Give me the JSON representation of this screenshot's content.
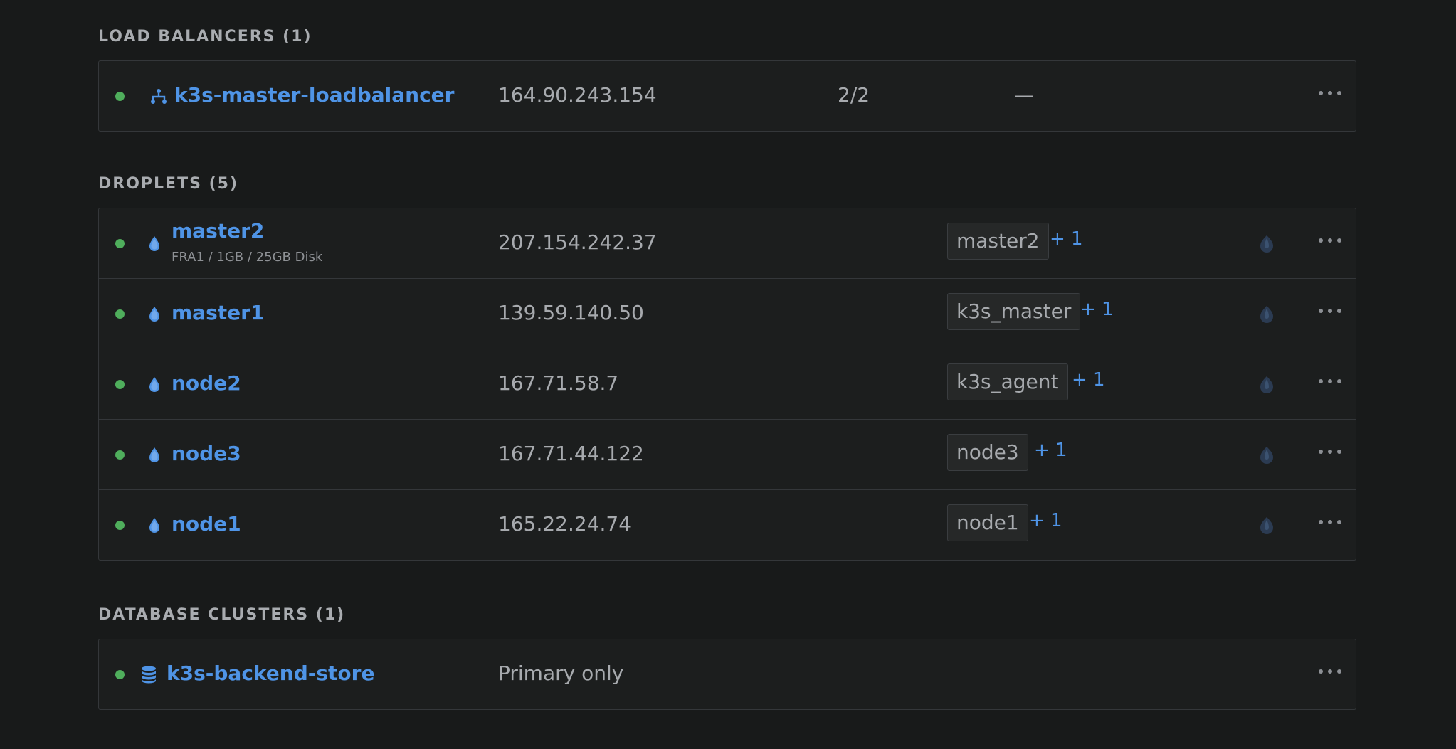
{
  "load_balancers": {
    "title": "LOAD BALANCERS (1)",
    "items": [
      {
        "name": "k3s-master-loadbalancer",
        "ip": "164.90.243.154",
        "count": "2/2",
        "dash": "—"
      }
    ]
  },
  "droplets": {
    "title": "DROPLETS (5)",
    "items": [
      {
        "name": "master2",
        "sub": "FRA1 / 1GB / 25GB Disk",
        "ip": "207.154.242.37",
        "tag": "master2",
        "more": "+ 1"
      },
      {
        "name": "master1",
        "ip": "139.59.140.50",
        "tag": "k3s_master",
        "more": "+ 1"
      },
      {
        "name": "node2",
        "ip": "167.71.58.7",
        "tag": "k3s_agent",
        "more": "+ 1"
      },
      {
        "name": "node3",
        "ip": "167.71.44.122",
        "tag": "node3",
        "more": "+ 1"
      },
      {
        "name": "node1",
        "ip": "165.22.24.74",
        "tag": "node1",
        "more": "+ 1"
      }
    ]
  },
  "database_clusters": {
    "title": "DATABASE CLUSTERS (1)",
    "items": [
      {
        "name": "k3s-backend-store",
        "status": "Primary only"
      }
    ]
  },
  "colors": {
    "background": "#181a1a",
    "link": "#4f94e6",
    "status_dot": "#4fae5c",
    "border": "#34373a"
  },
  "icons": {
    "load_balancer": "load-balancer-icon",
    "droplet": "droplet-icon",
    "database": "database-icon",
    "leaf": "leaf-icon",
    "more": "more-options-icon"
  }
}
